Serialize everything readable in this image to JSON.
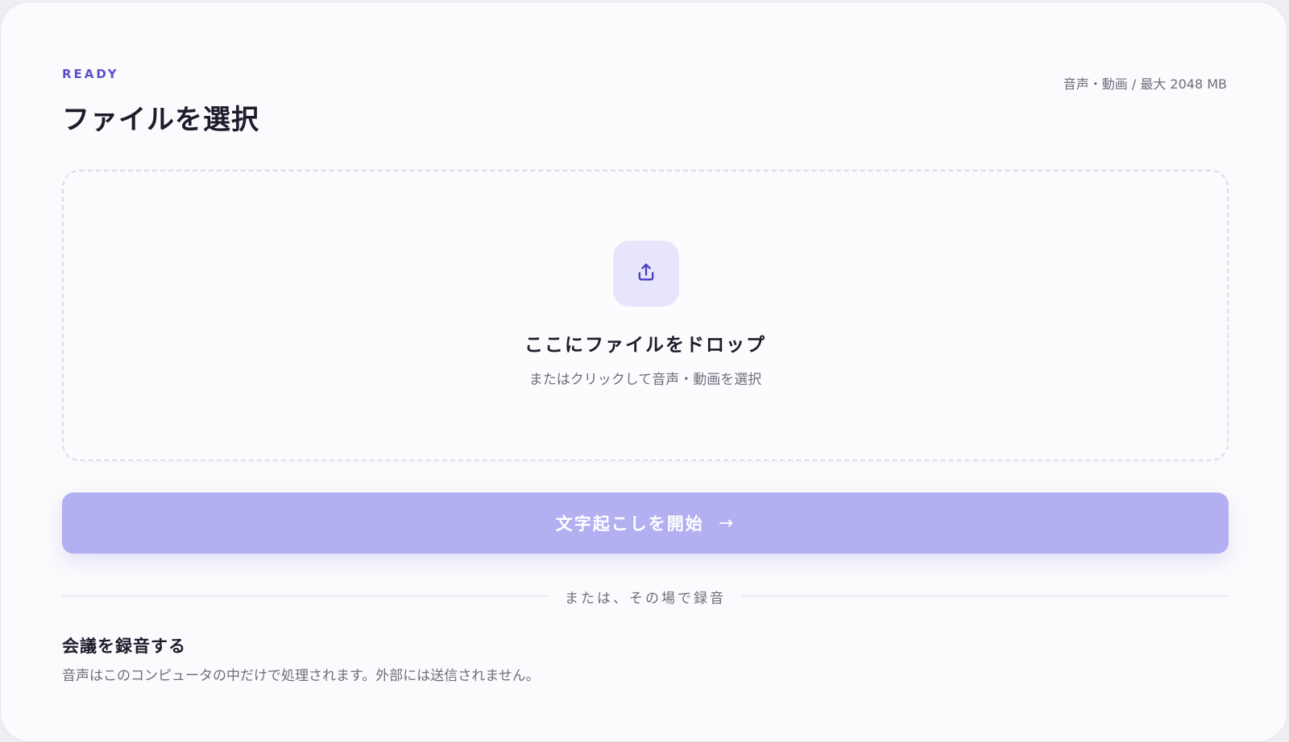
{
  "header": {
    "status": "READY",
    "title": "ファイルを選択",
    "limit": "音声・動画 / 最大 2048 MB"
  },
  "dropzone": {
    "icon": "upload-icon",
    "title": "ここにファイルをドロップ",
    "subtitle": "またはクリックして音声・動画を選択"
  },
  "start_button": {
    "label": "文字起こしを開始",
    "arrow": "→",
    "icon": "arrow-right-icon"
  },
  "divider": {
    "label": "または、その場で録音"
  },
  "recording": {
    "title": "会議を録音する",
    "description": "音声はこのコンピュータの中だけで処理されます。外部には送信されません。"
  },
  "colors": {
    "accent": "#5b4fd0",
    "button_bg": "#b3b0f2",
    "icon_tile_bg": "#e7e5fb",
    "text_primary": "#1c1c2b",
    "text_secondary": "#6d6d7c"
  }
}
